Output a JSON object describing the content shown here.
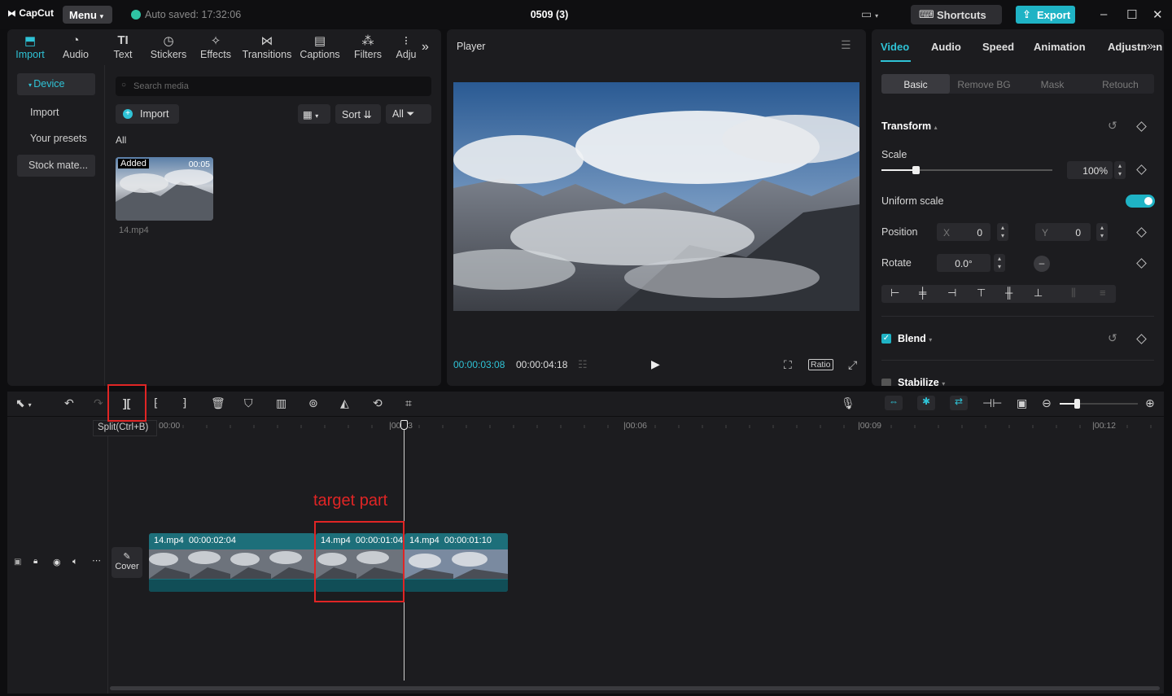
{
  "titlebar": {
    "logo": "CapCut",
    "menu": "Menu",
    "autosave": "Auto saved: 17:32:06",
    "project_title": "0509 (3)",
    "shortcuts": "Shortcuts",
    "export": "Export"
  },
  "media_tabs": [
    {
      "label": "Import",
      "icon": "import-icon"
    },
    {
      "label": "Audio",
      "icon": "audio-icon"
    },
    {
      "label": "Text",
      "icon": "text-icon"
    },
    {
      "label": "Stickers",
      "icon": "stickers-icon"
    },
    {
      "label": "Effects",
      "icon": "effects-icon"
    },
    {
      "label": "Transitions",
      "icon": "transitions-icon"
    },
    {
      "label": "Captions",
      "icon": "captions-icon"
    },
    {
      "label": "Filters",
      "icon": "filters-icon"
    },
    {
      "label": "Adju",
      "icon": "adjust-icon"
    }
  ],
  "sidebar": {
    "items": [
      "Device",
      "Import",
      "Your presets",
      "Stock mate..."
    ]
  },
  "media": {
    "search_placeholder": "Search media",
    "import_label": "Import",
    "sort_label": "Sort",
    "filter_label": "All",
    "section_label": "All",
    "item": {
      "badge": "Added",
      "duration": "00:05",
      "filename": "14.mp4"
    }
  },
  "player": {
    "title": "Player",
    "current_time": "00:00:03:08",
    "total_time": "00:00:04:18",
    "ratio_label": "Ratio"
  },
  "props": {
    "tabs": [
      "Video",
      "Audio",
      "Speed",
      "Animation",
      "Adjustmen"
    ],
    "subtabs": [
      "Basic",
      "Remove BG",
      "Mask",
      "Retouch"
    ],
    "transform_label": "Transform",
    "scale_label": "Scale",
    "scale_value": "100%",
    "scale_fraction": 0.2,
    "uniform_scale_label": "Uniform scale",
    "uniform_scale_on": true,
    "position_label": "Position",
    "pos_x_label": "X",
    "pos_x": "0",
    "pos_y_label": "Y",
    "pos_y": "0",
    "rotate_label": "Rotate",
    "rotate_value": "0.0°",
    "blend_label": "Blend",
    "stabilize_label": "Stabilize"
  },
  "timeline": {
    "tooltip": "Split(Ctrl+B)",
    "ruler": [
      "00:00",
      "|00:03",
      "|00:06",
      "|00:09",
      "|00:12"
    ],
    "cover_label": "Cover",
    "annotation": "target part",
    "clips": [
      {
        "name": "14.mp4",
        "duration": "00:00:02:04"
      },
      {
        "name": "14.mp4",
        "duration": "00:00:01:04"
      },
      {
        "name": "14.mp4",
        "duration": "00:00:01:10"
      }
    ]
  },
  "colors": {
    "accent": "#2fc3d6",
    "clip": "#1d6f7a",
    "annotation": "#e02525"
  }
}
